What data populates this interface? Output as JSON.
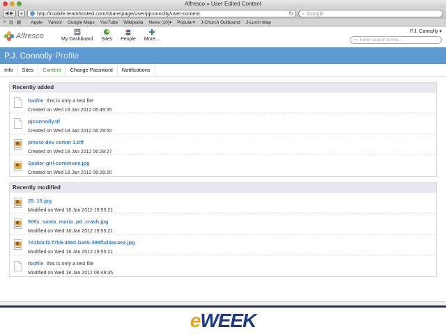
{
  "browser": {
    "title": "Alfresco » User Edited Content",
    "url": "http://mobile.teamhosted.com/share/page/user/pjconnolly/user-content",
    "search_placeholder": "Google",
    "bookmarks": [
      "Apple",
      "Yahoo!",
      "Google Maps",
      "YouTube",
      "Wikipedia",
      "News (10)▾",
      "Popular▾",
      "J-Church Outbound",
      "J-Lurch Map"
    ]
  },
  "app": {
    "logo": "Alfresco",
    "nav": [
      {
        "label": "My Dashboard",
        "icon": "dashboard-icon"
      },
      {
        "label": "Sites",
        "icon": "sites-icon"
      },
      {
        "label": "People",
        "icon": "people-icon"
      },
      {
        "label": "More...",
        "icon": "plus-icon"
      }
    ],
    "user_menu": "P.J. Connolly ▾",
    "search_placeholder": "Enter search terms..."
  },
  "profile": {
    "name": "P.J. Connolly",
    "suffix": "Profile"
  },
  "tabs": [
    "Info",
    "Sites",
    "Content",
    "Change Password",
    "Notifications"
  ],
  "active_tab": "Content",
  "recently_added": {
    "heading": "Recently added",
    "items": [
      {
        "name": "foofile",
        "desc": "this is only a test file",
        "meta": "Created on Wed 18 Jan 2012 06:49:35",
        "icon": "document-icon"
      },
      {
        "name": "pjconnolly.tif",
        "desc": "",
        "meta": "Created on Wed 18 Jan 2012 06:29:50",
        "icon": "document-icon"
      },
      {
        "name": "presto dev comm 1.tiff",
        "desc": "",
        "meta": "Created on Wed 18 Jan 2012 06:29:27",
        "icon": "image-icon"
      },
      {
        "name": "Spider-girl-continues.jpg",
        "desc": "",
        "meta": "Created on Wed 18 Jan 2012 06:29:20",
        "icon": "image-icon"
      }
    ]
  },
  "recently_modified": {
    "heading": "Recently modified",
    "items": [
      {
        "name": "25_15.jpg",
        "desc": "",
        "meta": "Modified on Wed 18 Jan 2012 19:55:21",
        "icon": "image-icon"
      },
      {
        "name": "500x_santa_maria_pd_crash.jpg",
        "desc": "",
        "meta": "Modified on Wed 18 Jan 2012 19:55:21",
        "icon": "image-icon"
      },
      {
        "name": "741b0cf2-f7b9-4860-ba55-399fbd3ac4e2.jpg",
        "desc": "",
        "meta": "Modified on Wed 18 Jan 2012 19:55:21",
        "icon": "image-icon"
      },
      {
        "name": "foofile",
        "desc": "this is only a test file",
        "meta": "Modified on Wed 18 Jan 2012 06:49:35",
        "icon": "document-icon"
      }
    ]
  },
  "watermark": "eWEEK",
  "colors": {
    "profile_bar": "#5d9ad2",
    "link": "#3b7ec2",
    "active_tab": "#3d8a2f"
  }
}
